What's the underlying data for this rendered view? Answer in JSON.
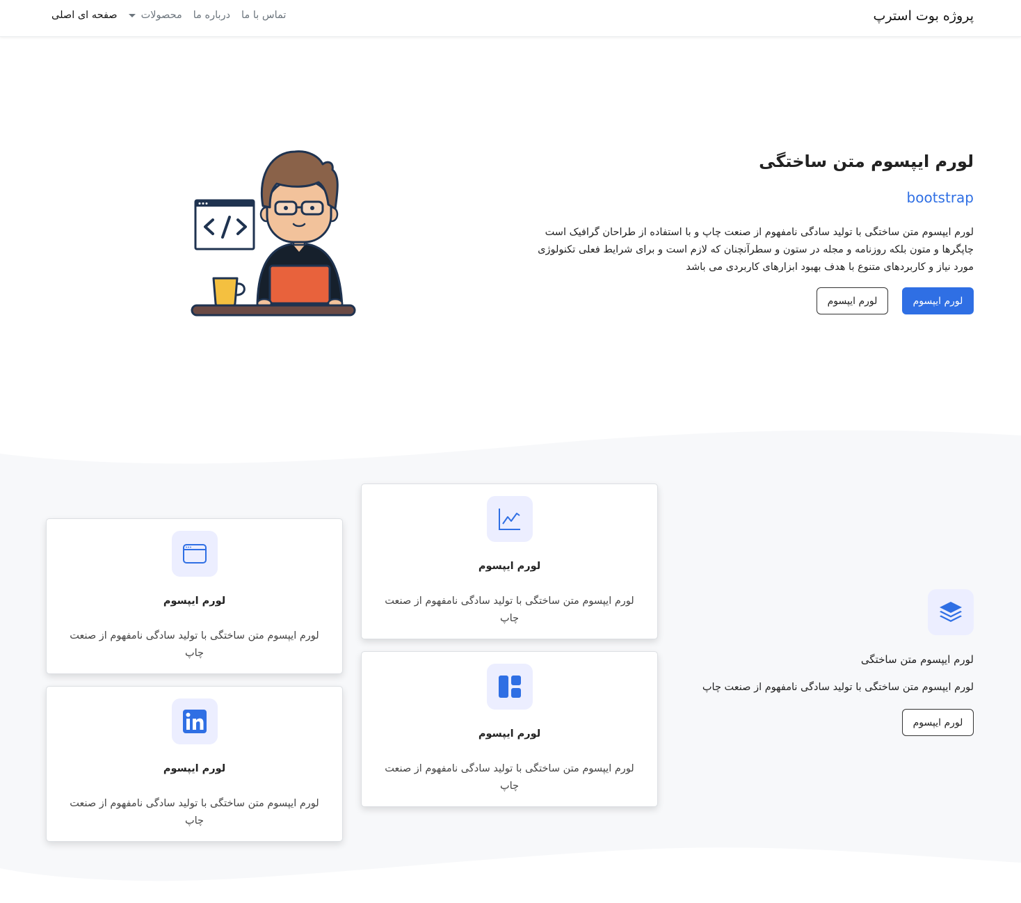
{
  "navbar": {
    "brand": "پروژه بوت استرپ",
    "links": [
      {
        "label": "صفحه ای اصلی",
        "active": true
      },
      {
        "label": "محصولات",
        "dropdown": true
      },
      {
        "label": "درباره ما"
      },
      {
        "label": "تماس با ما"
      }
    ]
  },
  "hero": {
    "title": "لورم ایپسوم متن ساختگی",
    "subtitle": "bootstrap",
    "text": "لورم ایپسوم متن ساختگی با تولید سادگی نامفهوم از صنعت چاپ و با استفاده از طراحان گرافیک است چاپگرها و متون بلکه روزنامه و مجله در ستون و سطرآنچنان که لازم است و برای شرایط فعلی تکنولوژی مورد نیاز و کاربردهای متنوع با هدف بهبود ابزارهای کاربردی می باشد",
    "primary_button": "لورم ایپسوم",
    "secondary_button": "لورم ایپسوم"
  },
  "cards": [
    {
      "icon": "chart-line-icon",
      "title": "لورم ایپسوم",
      "text": "لورم ایپسوم متن ساختگی با تولید سادگی نامفهوم از صنعت چاپ"
    },
    {
      "icon": "layout-icon",
      "title": "لورم ایپسوم",
      "text": "لورم ایپسوم متن ساختگی با تولید سادگی نامفهوم از صنعت چاپ"
    },
    {
      "icon": "browser-window-icon",
      "title": "لورم ایپسوم",
      "text": "لورم ایپسوم متن ساختگی با تولید سادگی نامفهوم از صنعت چاپ"
    },
    {
      "icon": "linkedin-icon",
      "title": "لورم ایپسوم",
      "text": "لورم ایپسوم متن ساختگی با تولید سادگی نامفهوم از صنعت چاپ"
    }
  ],
  "feature": {
    "icon": "layers-icon",
    "title": "لورم ایپسوم متن ساختگی",
    "text": "لورم ایپسوم متن ساختگی با تولید سادگی نامفهوم از صنعت چاپ",
    "button": "لورم ایپسوم"
  },
  "colors": {
    "primary": "#2f6fe4",
    "icon_bg": "#eceeff",
    "section_bg": "#f7f8fa"
  }
}
